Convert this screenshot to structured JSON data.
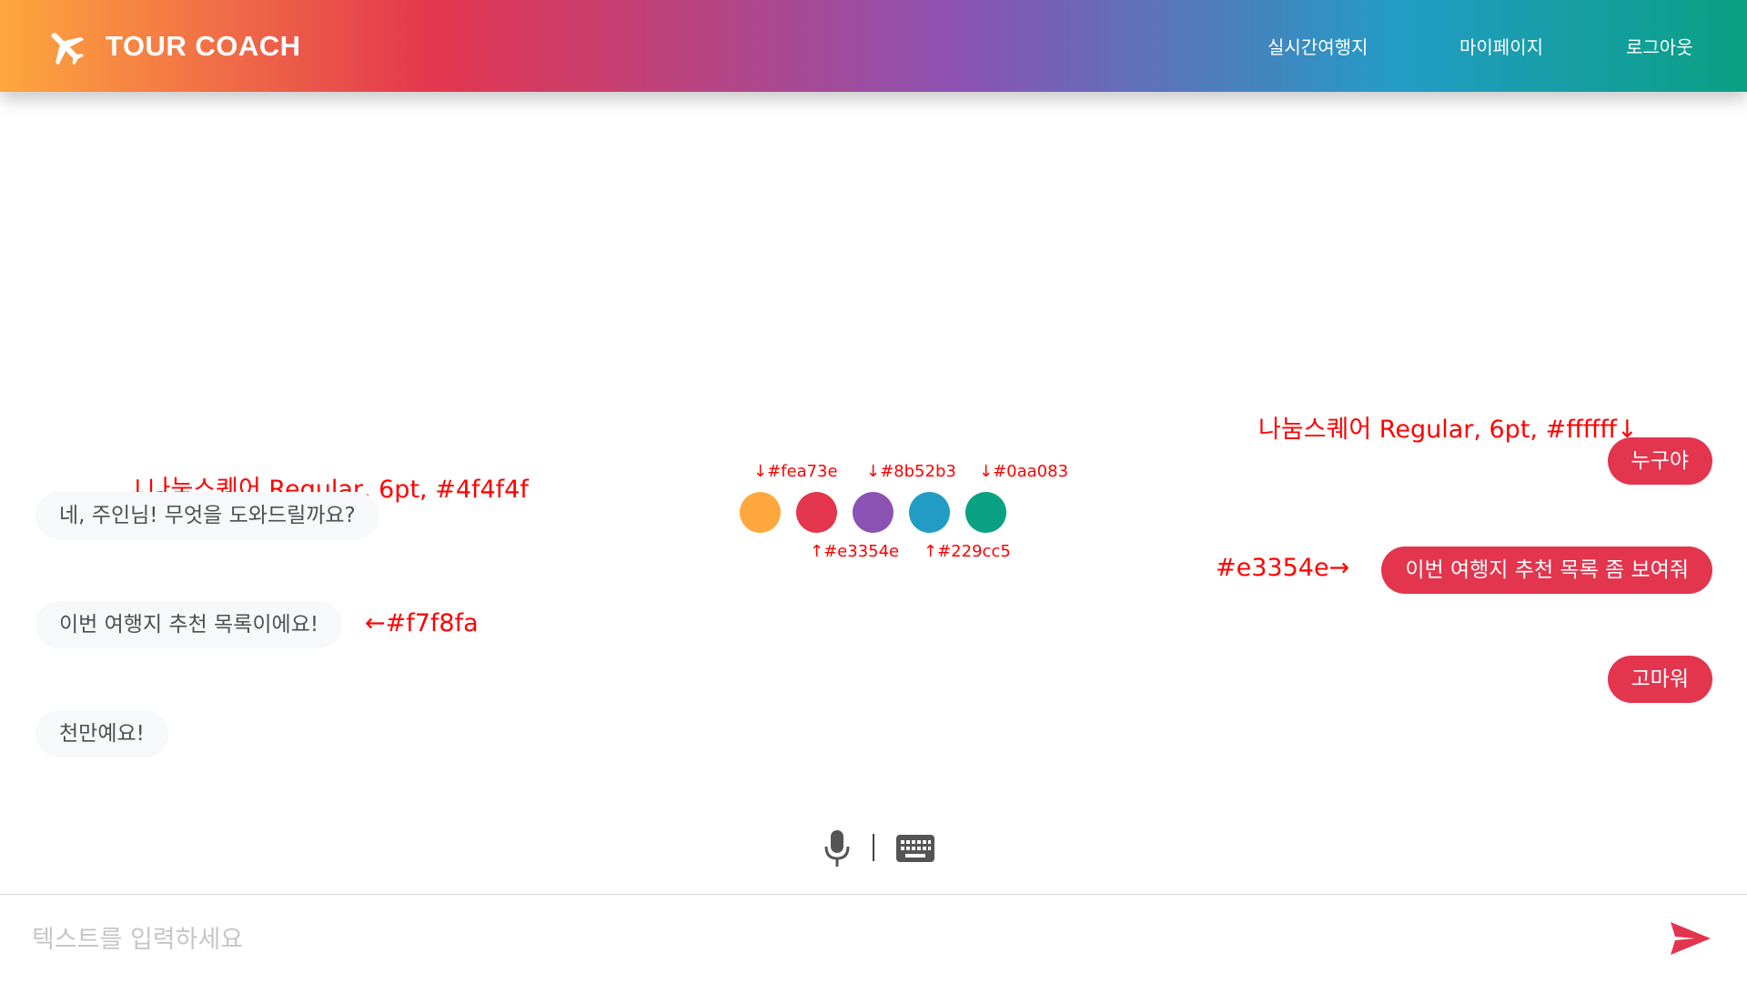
{
  "header": {
    "logo_text": "TOUR COACH",
    "nav": [
      "실시간여행지",
      "마이페이지",
      "로그아웃"
    ]
  },
  "colors": {
    "orange": "#fea73e",
    "red": "#e3354e",
    "purple": "#8b52b3",
    "blue": "#229cc5",
    "green": "#0aa083",
    "bot_bubble": "#f7f8fa",
    "bot_text": "#4f4f4f",
    "user_text": "#ffffff"
  },
  "chat": {
    "bot_messages": [
      "네, 주인님! 무엇을 도와드릴까요?",
      "이번 여행지 추천 목록이에요!",
      "천만예요!"
    ],
    "user_messages": [
      "누구야",
      "이번 여행지 추천 목록 좀 보여줘",
      "고마워"
    ]
  },
  "annotations": {
    "bot_font": "↓나눔스퀘어 Regular, 6pt, #4f4f4f",
    "user_font": "나눔스퀘어 Regular, 6pt, #ffffff↓",
    "bot_bubble_color": "←#f7f8fa",
    "user_bubble_color": "#e3354e→",
    "swatch_labels_top": [
      "↓#fea73e",
      "↓#8b52b3",
      "↓#0aa083"
    ],
    "swatch_labels_bottom": [
      "↑#e3354e",
      "↑#229cc5"
    ]
  },
  "input": {
    "placeholder": "텍스트를 입력하세요"
  },
  "icons": {
    "logo": "airplane-icon",
    "mic": "microphone-icon",
    "keyboard": "keyboard-icon",
    "send": "send-icon"
  }
}
